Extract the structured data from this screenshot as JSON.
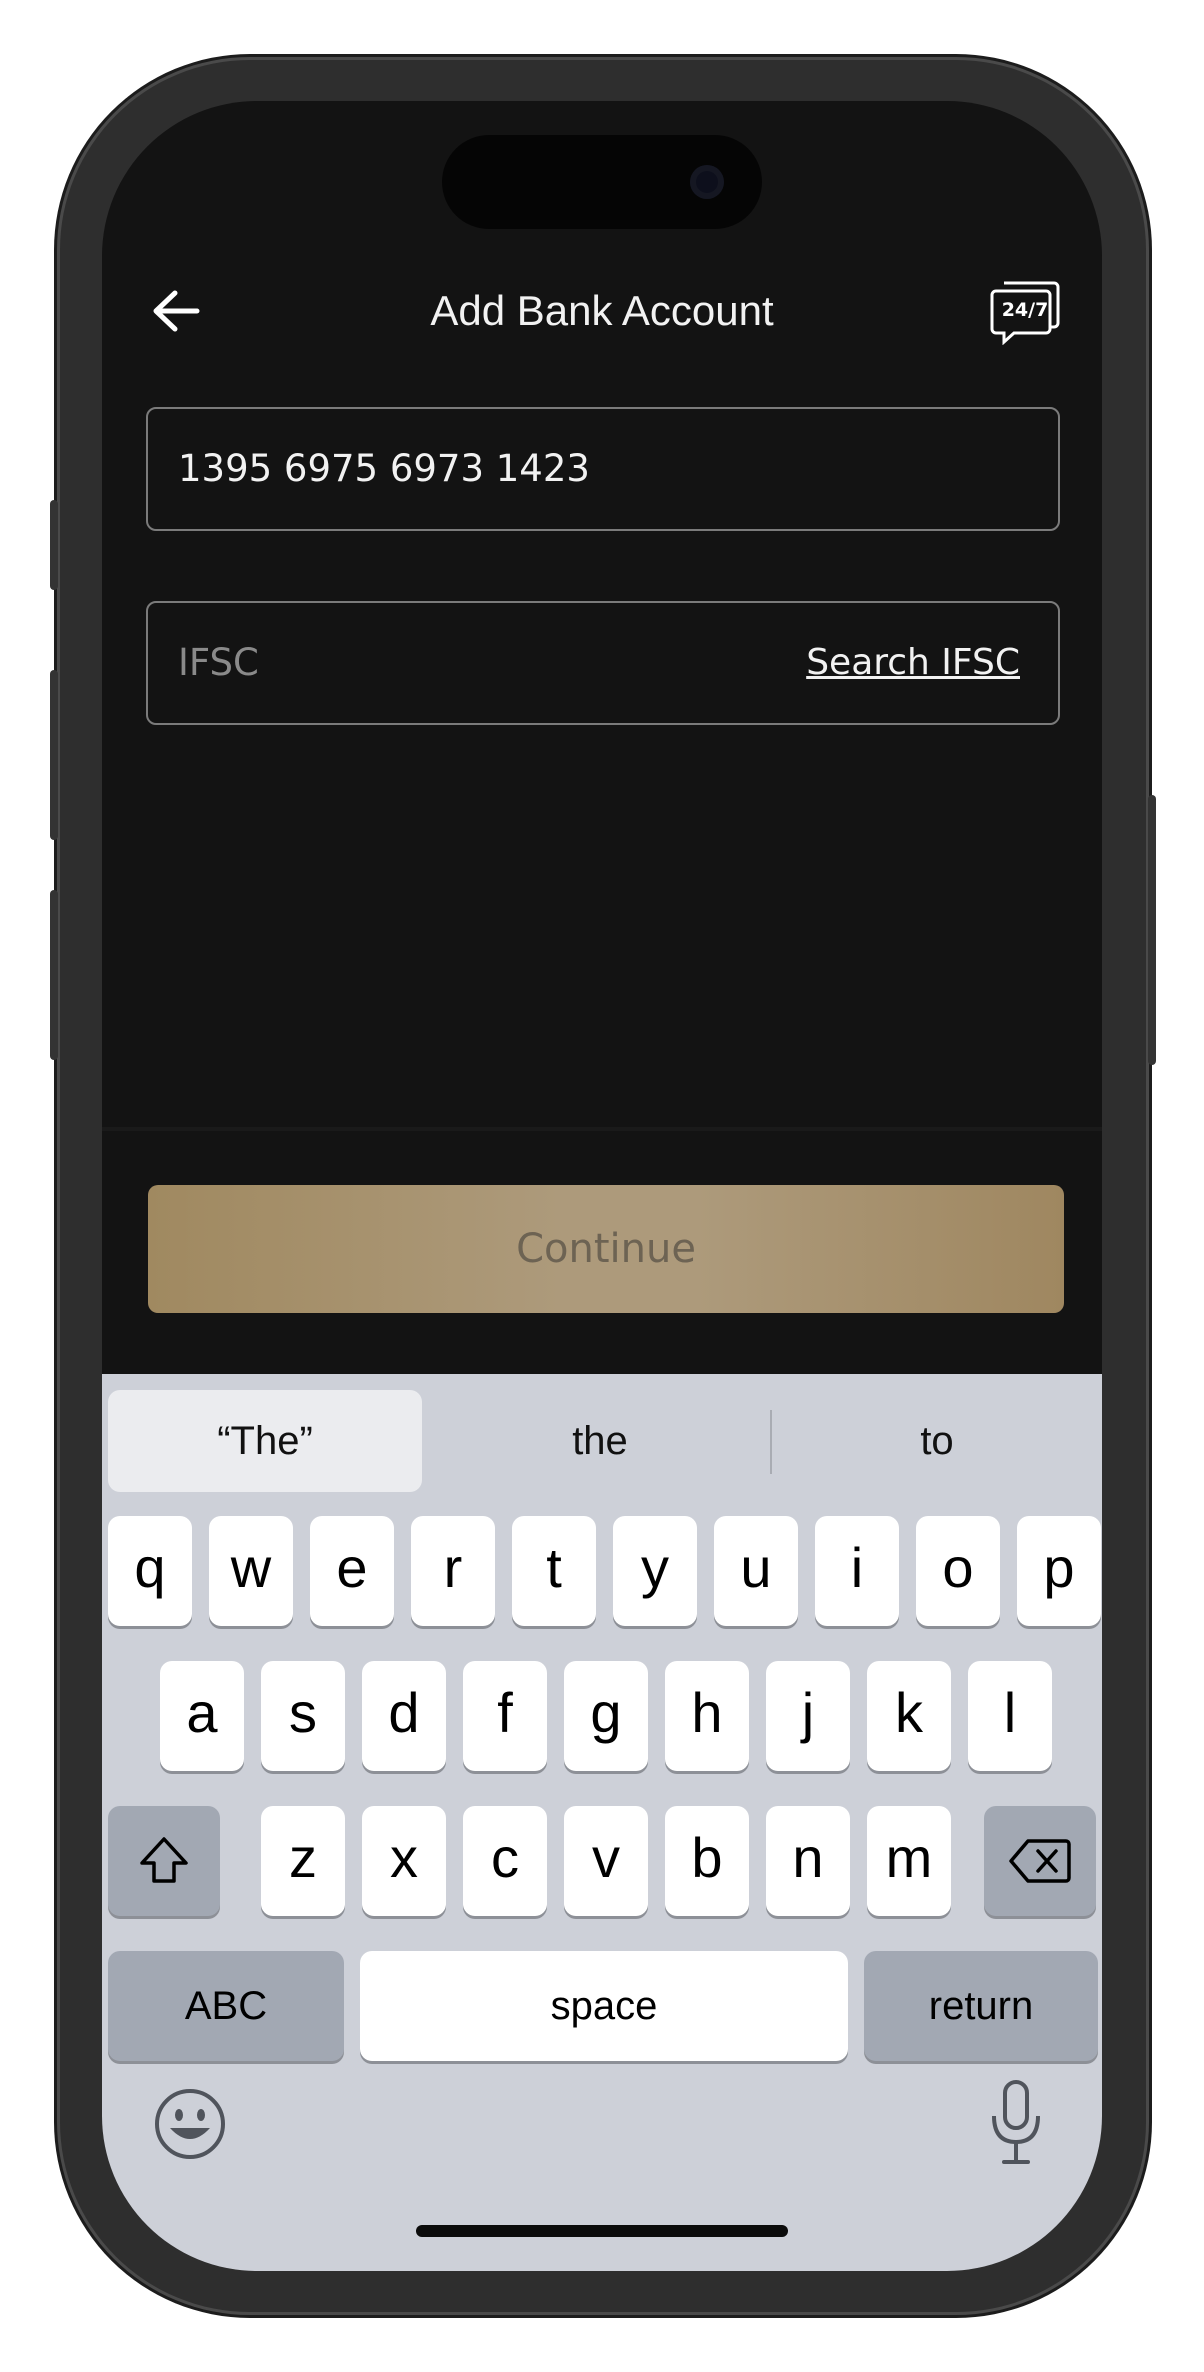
{
  "header": {
    "title": "Add Bank Account",
    "support_badge": "24/7"
  },
  "form": {
    "account_number_value": "1395 6975 6973 1423",
    "ifsc_placeholder": "IFSC",
    "search_ifsc_label": "Search IFSC"
  },
  "continue_label": "Continue",
  "keyboard": {
    "suggestions": [
      "“The”",
      "the",
      "to"
    ],
    "row1": [
      "q",
      "w",
      "e",
      "r",
      "t",
      "y",
      "u",
      "i",
      "o",
      "p"
    ],
    "row2": [
      "a",
      "s",
      "d",
      "f",
      "g",
      "h",
      "j",
      "k",
      "l"
    ],
    "row3": [
      "z",
      "x",
      "c",
      "v",
      "b",
      "n",
      "m"
    ],
    "abc_label": "ABC",
    "space_label": "space",
    "return_label": "return"
  },
  "icons": {
    "back": "arrow-left",
    "support": "chat-24-7",
    "shift": "shift-arrow-up",
    "delete": "backspace",
    "emoji": "smiley-face",
    "mic": "microphone"
  },
  "colors": {
    "background": "#131313",
    "button_gold": "#a69070",
    "keyboard_bg": "#cdd0d8"
  }
}
